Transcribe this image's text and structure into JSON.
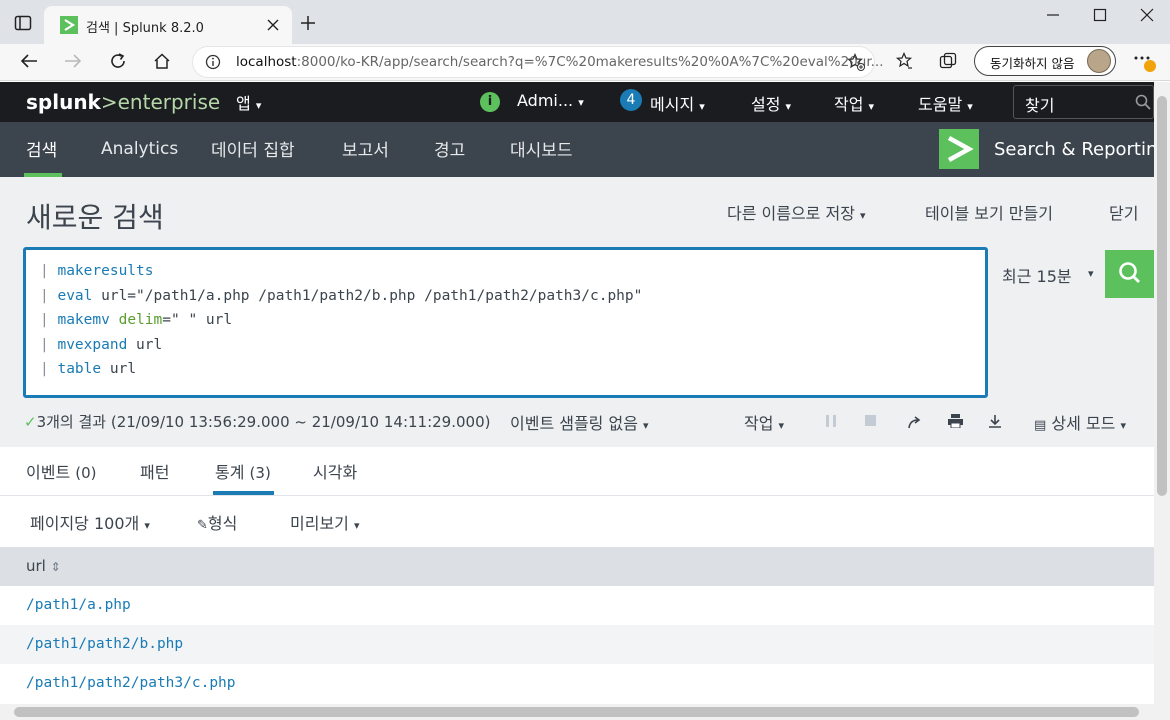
{
  "browser": {
    "tab_title": "검색 | Splunk 8.2.0",
    "url_host": "localhost",
    "url_rest": ":8000/ko-KR/app/search/search?q=%7C%20makeresults%20%0A%7C%20eval%20ur...",
    "sync_label": "동기화하지 않음"
  },
  "topbar": {
    "logo_a": "splunk",
    "logo_b": ">enterprise",
    "app_menu": "앱",
    "user": "Admi...",
    "messages_count": "4",
    "messages": "메시지",
    "settings": "설정",
    "activity": "작업",
    "help": "도움말",
    "find": "찾기"
  },
  "appbar": {
    "tabs": [
      "검색",
      "Analytics",
      "데이터 집합",
      "보고서",
      "경고",
      "대시보드"
    ],
    "app_title": "Search & Reporting"
  },
  "page": {
    "title": "새로운 검색",
    "save_as": "다른 이름으로 저장",
    "create_table": "테이블 보기 만들기",
    "close": "닫기"
  },
  "search": {
    "lines": [
      {
        "cmd": "makeresults",
        "rest": ""
      },
      {
        "cmd": "eval",
        "rest": " url=\"/path1/a.php /path1/path2/b.php /path1/path2/path3/c.php\""
      },
      {
        "cmd": "makemv",
        "arg": " delim",
        "rest": "=\" \" url"
      },
      {
        "cmd": "mvexpand",
        "rest": " url"
      },
      {
        "cmd": "table",
        "rest": " url"
      }
    ],
    "time_range": "최근 15분"
  },
  "status": {
    "result": "3개의 결과 (21/09/10 13:56:29.000 ~ 21/09/10 14:11:29.000)",
    "sampling": "이벤트 샘플링 없음",
    "job": "작업",
    "mode": "상세 모드"
  },
  "result_tabs": [
    {
      "label": "이벤트",
      "count": "(0)"
    },
    {
      "label": "패턴",
      "count": ""
    },
    {
      "label": "통계",
      "count": "(3)"
    },
    {
      "label": "시각화",
      "count": ""
    }
  ],
  "options": {
    "per_page": "페이지당 100개",
    "format": "형식",
    "preview": "미리보기"
  },
  "table": {
    "column": "url",
    "rows": [
      "/path1/a.php",
      "/path1/path2/b.php",
      "/path1/path2/path3/c.php"
    ]
  },
  "colors": {
    "accent": "#5cc05c",
    "link": "#1a7bb5",
    "topbar": "#1a1c20",
    "appbar": "#3c444d"
  }
}
